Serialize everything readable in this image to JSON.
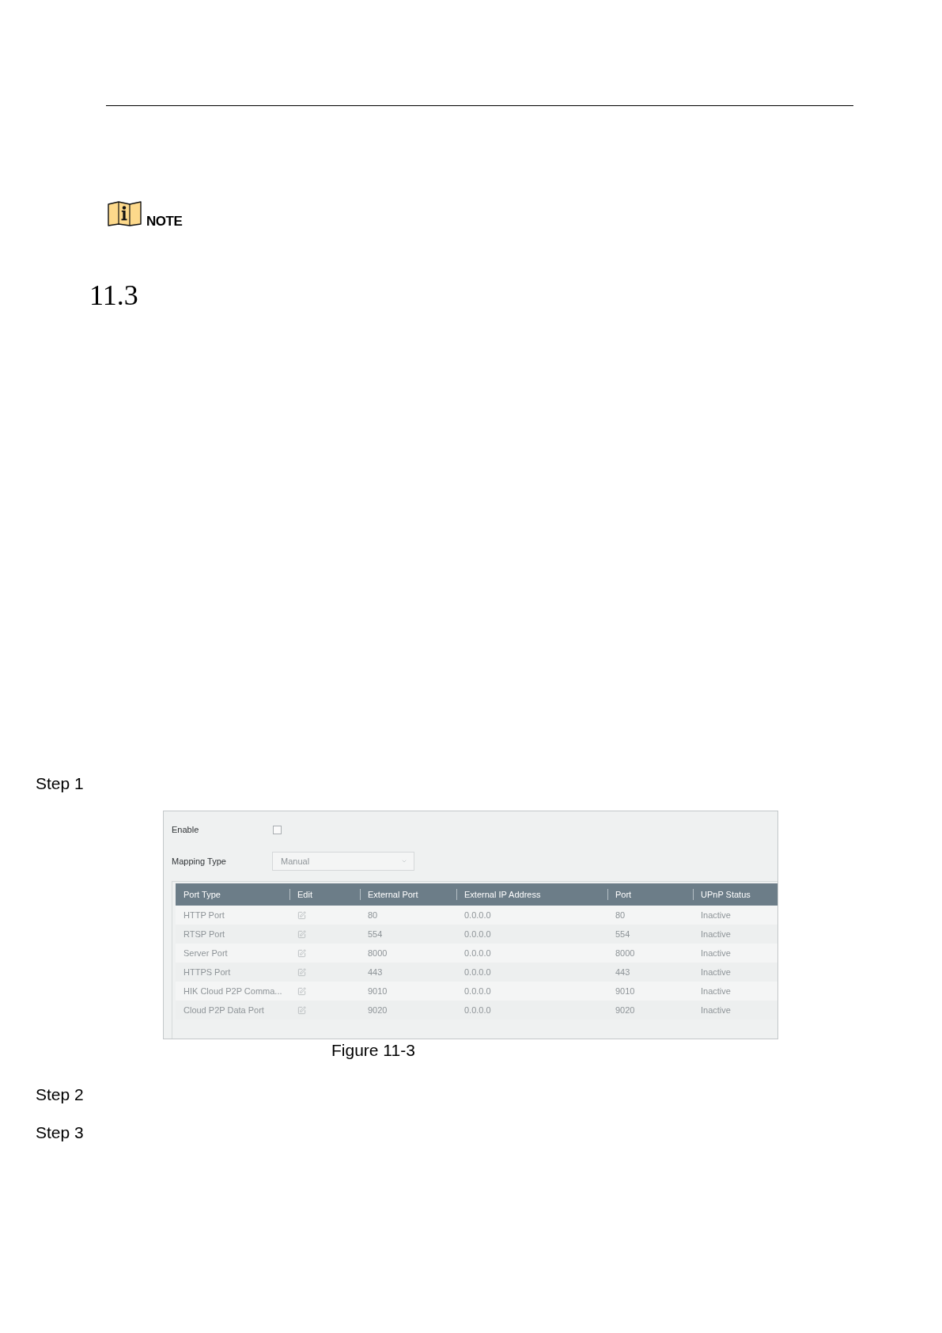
{
  "note": {
    "label": "NOTE"
  },
  "section": {
    "number": "11.3"
  },
  "blocks": [
    {
      "kind": "step",
      "label": "Step 1"
    },
    {
      "kind": "figure",
      "caption": "Figure 11-3",
      "screenshot": {
        "enable": {
          "label": "Enable",
          "checked": false
        },
        "mapping_type": {
          "label": "Mapping Type",
          "value": "Manual",
          "disabled": true
        },
        "table": {
          "disabled": true,
          "columns": [
            "Port Type",
            "Edit",
            "External Port",
            "External IP Address",
            "Port",
            "UPnP Status"
          ],
          "rows": [
            {
              "port_type": "HTTP Port",
              "external_port": "80",
              "external_ip": "0.0.0.0",
              "port": "80",
              "upnp_status": "Inactive"
            },
            {
              "port_type": "RTSP Port",
              "external_port": "554",
              "external_ip": "0.0.0.0",
              "port": "554",
              "upnp_status": "Inactive"
            },
            {
              "port_type": "Server Port",
              "external_port": "8000",
              "external_ip": "0.0.0.0",
              "port": "8000",
              "upnp_status": "Inactive"
            },
            {
              "port_type": "HTTPS Port",
              "external_port": "443",
              "external_ip": "0.0.0.0",
              "port": "443",
              "upnp_status": "Inactive"
            },
            {
              "port_type": "HIK Cloud P2P Comma...",
              "external_port": "9010",
              "external_ip": "0.0.0.0",
              "port": "9010",
              "upnp_status": "Inactive"
            },
            {
              "port_type": "Cloud P2P Data Port",
              "external_port": "9020",
              "external_ip": "0.0.0.0",
              "port": "9020",
              "upnp_status": "Inactive"
            }
          ]
        }
      }
    },
    {
      "kind": "step",
      "label": "Step 2"
    },
    {
      "kind": "step",
      "label": "Step 3"
    }
  ]
}
